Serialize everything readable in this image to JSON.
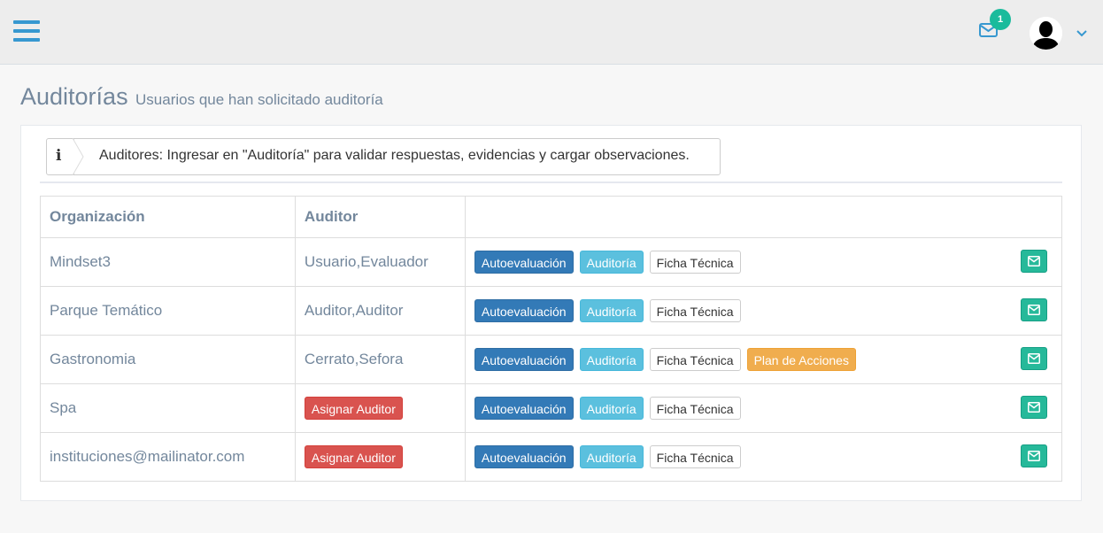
{
  "topbar": {
    "notification_count": "1",
    "icons": [
      "hamburger-icon",
      "envelope-icon",
      "user-avatar",
      "chevron-down-icon"
    ]
  },
  "header": {
    "title": "Auditorías",
    "subtitle": "Usuarios que han solicitado auditoría"
  },
  "alert": {
    "icon": "info-icon",
    "message": "Auditores: Ingresar en \"Auditoría\" para validar respuestas, evidencias y cargar observaciones."
  },
  "table": {
    "columns": [
      "Organización",
      "Auditor",
      ""
    ],
    "rows": [
      {
        "organization": "Mindset3",
        "auditor": "Usuario,Evaluador",
        "assign_label": "",
        "actions": [
          "Autoevaluación",
          "Auditoría",
          "Ficha Técnica"
        ]
      },
      {
        "organization": "Parque Temático",
        "auditor": "Auditor,Auditor",
        "assign_label": "",
        "actions": [
          "Autoevaluación",
          "Auditoría",
          "Ficha Técnica"
        ]
      },
      {
        "organization": "Gastronomia",
        "auditor": "Cerrato,Sefora",
        "assign_label": "",
        "actions": [
          "Autoevaluación",
          "Auditoría",
          "Ficha Técnica",
          "Plan de Acciones"
        ]
      },
      {
        "organization": "Spa",
        "auditor": "",
        "assign_label": "Asignar Auditor",
        "actions": [
          "Autoevaluación",
          "Auditoría",
          "Ficha Técnica"
        ]
      },
      {
        "organization": "instituciones@mailinator.com",
        "auditor": "",
        "assign_label": "Asignar Auditor",
        "actions": [
          "Autoevaluación",
          "Auditoría",
          "Ficha Técnica"
        ]
      }
    ]
  },
  "colors": {
    "accent_blue": "#3798d0",
    "primary": "#337ab7",
    "info": "#5bc0de",
    "warning": "#f0ad4e",
    "danger": "#d9534f",
    "success": "#26B99A"
  }
}
